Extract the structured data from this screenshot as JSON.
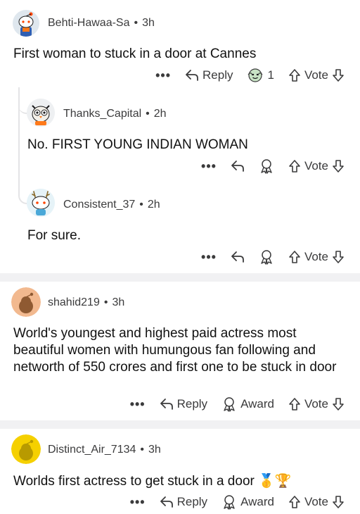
{
  "comments": [
    {
      "username": "Behti-Hawaa-Sa",
      "age": "3h",
      "text": "First woman to stuck in a door at Cannes",
      "reply_label": "Reply",
      "award_count": "1",
      "vote_label": "Vote"
    },
    {
      "username": "Thanks_Capital",
      "age": "2h",
      "text": "No. FIRST YOUNG INDIAN WOMAN",
      "vote_label": "Vote"
    },
    {
      "username": "Consistent_37",
      "age": "2h",
      "text": "For sure.",
      "vote_label": "Vote"
    },
    {
      "username": "shahid219",
      "age": "3h",
      "text": "World's youngest and highest paid actress most beautiful women with humungous fan following and networth of 550 crores and first one to be stuck in door",
      "reply_label": "Reply",
      "award_label": "Award",
      "vote_label": "Vote"
    },
    {
      "username": "Distinct_Air_7134",
      "age": "3h",
      "text": "Worlds first actress to get stuck in a door",
      "emoji": "🥇🏆",
      "reply_label": "Reply",
      "award_label": "Award",
      "vote_label": "Vote"
    }
  ],
  "more_glyph": "•••",
  "separator_dot": "•",
  "colors": {
    "separator": "#f1f1f3",
    "text": "#1a1a1b",
    "meta": "#3b3b3c",
    "thread_line": "#e4e4e6"
  }
}
